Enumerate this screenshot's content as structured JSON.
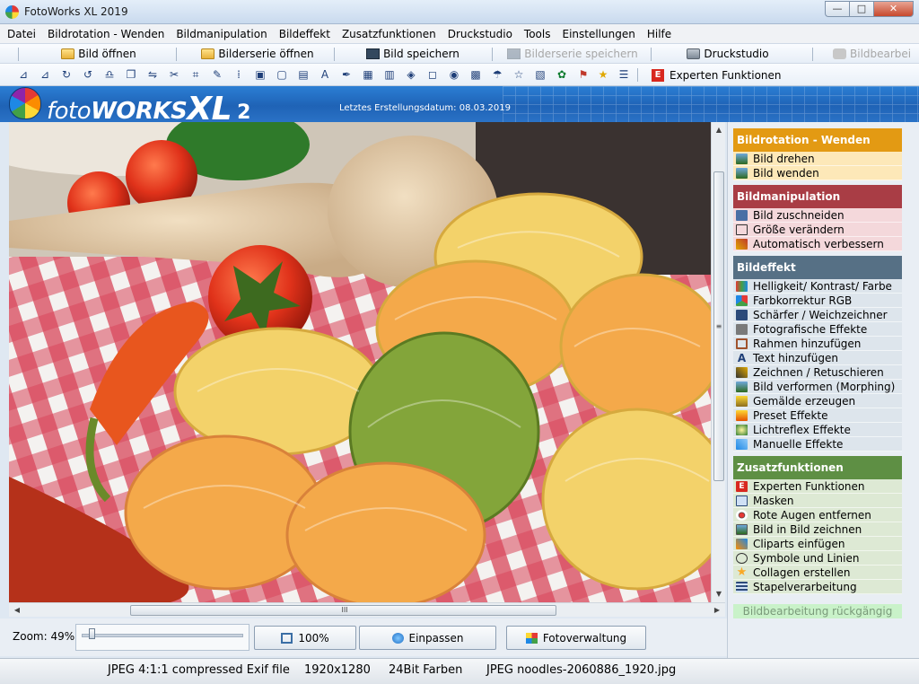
{
  "window": {
    "title": "FotoWorks XL 2019",
    "controls": {
      "minimize": "—",
      "maximize": "□",
      "close": "✕"
    }
  },
  "menu": [
    "Datei",
    "Bildrotation - Wenden",
    "Bildmanipulation",
    "Bildeffekt",
    "Zusatzfunktionen",
    "Druckstudio",
    "Tools",
    "Einstellungen",
    "Hilfe"
  ],
  "toolbar": {
    "open_image": "Bild öffnen",
    "open_series": "Bilderserie öffnen",
    "save_image": "Bild speichern",
    "save_series": "Bilderserie speichern",
    "print_studio": "Druckstudio",
    "edit": "Bildbearbei"
  },
  "expert_button": {
    "badge": "E",
    "label": "Experten Funktionen"
  },
  "banner": {
    "logo_foto": "foto",
    "logo_works": "WORKS",
    "logo_xl": "XL",
    "logo_num": "2",
    "last_created": "Letztes Erstellungsdatum: 08.03.2019"
  },
  "scroll_arrows": {
    "up": "▲",
    "down": "▼",
    "left": "◀",
    "right": "▶",
    "grip_v": "≡",
    "grip_h": "III"
  },
  "zoom": {
    "label": "Zoom: 49%",
    "value_percent": 49
  },
  "buttons": {
    "full_size": "100%",
    "fit": "Einpassen",
    "photo_manager": "Fotoverwaltung"
  },
  "status": {
    "format": "JPEG 4:1:1 compressed Exif file",
    "dimensions": "1920x1280",
    "color_depth": "24Bit Farben",
    "file": "JPEG noodles-2060886_1920.jpg"
  },
  "panel": {
    "rotation": {
      "title": "Bildrotation - Wenden",
      "color": "#e39a13",
      "item_color": "#fde8b8",
      "items": [
        "Bild drehen",
        "Bild wenden"
      ]
    },
    "manipulation": {
      "title": "Bildmanipulation",
      "color": "#a93d45",
      "item_color": "#f4d8db",
      "items": [
        "Bild zuschneiden",
        "Größe verändern",
        "Automatisch verbessern"
      ]
    },
    "effect": {
      "title": "Bildeffekt",
      "color": "#567085",
      "item_color": "#dde5ec",
      "items": [
        "Helligkeit/ Kontrast/ Farbe",
        "Farbkorrektur RGB",
        "Schärfer / Weichzeichner",
        "Fotografische Effekte",
        "Rahmen hinzufügen",
        "Text hinzufügen",
        "Zeichnen / Retuschieren",
        "Bild verformen (Morphing)",
        "Gemälde erzeugen",
        "Preset Effekte",
        "Lichtreflex Effekte",
        "Manuelle Effekte"
      ]
    },
    "extras": {
      "title": "Zusatzfunktionen",
      "color": "#5e8f44",
      "item_color": "#dde9d4",
      "items": [
        "Experten Funktionen",
        "Masken",
        "Rote Augen entfernen",
        "Bild in Bild zeichnen",
        "Cliparts einfügen",
        "Symbole und Linien",
        "Collagen erstellen",
        "Stapelverarbeitung"
      ]
    },
    "undo": "Bildbearbeitung rückgängig"
  },
  "tool_icons": [
    "⊿",
    "⊿",
    "↻",
    "↺",
    "♎",
    "❐",
    "⇋",
    "✂",
    "⌗",
    "✎",
    "⁞",
    "▣",
    "▢",
    "▤",
    "A",
    "✒",
    "▦",
    "▥",
    "◈",
    "◻",
    "◉",
    "▩",
    "☂",
    "☆",
    "▧"
  ]
}
